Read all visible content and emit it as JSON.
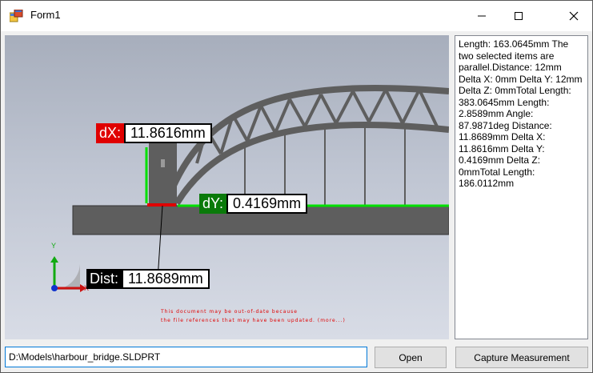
{
  "window": {
    "title": "Form1",
    "icon": "form-app-icon"
  },
  "viewport": {
    "model": "harbour-bridge",
    "callouts": {
      "dx": {
        "tag": "dX:",
        "value": "11.8616mm",
        "color": "#e00000"
      },
      "dy": {
        "tag": "dY:",
        "value": "0.4169mm",
        "color": "#0a7a0a"
      },
      "dist": {
        "tag": "Dist:",
        "value": "11.8689mm",
        "color": "#000000"
      }
    },
    "warning_line1": "This document may be out-of-date because",
    "warning_line2": "the file references that may have been updated. (more...)",
    "triad": {
      "y_label": "Y",
      "x_label": "X"
    }
  },
  "info_panel": {
    "text": "Length: 163.0645mm The two selected items are parallel.Distance: 12mm Delta X: 0mm  Delta Y: 12mm  Delta Z: 0mmTotal Length: 383.0645mm Length: 2.8589mm Angle: 87.9871deg Distance: 11.8689mm Delta X: 11.8616mm  Delta Y: 0.4169mm  Delta Z: 0mmTotal Length: 186.0112mm"
  },
  "controls": {
    "path_value": "D:\\Models\\harbour_bridge.SLDPRT",
    "open_label": "Open",
    "capture_label": "Capture Measurement"
  },
  "colors": {
    "selection_green": "#00e000",
    "selection_red": "#e00000",
    "steel": "#5e5e5e"
  }
}
